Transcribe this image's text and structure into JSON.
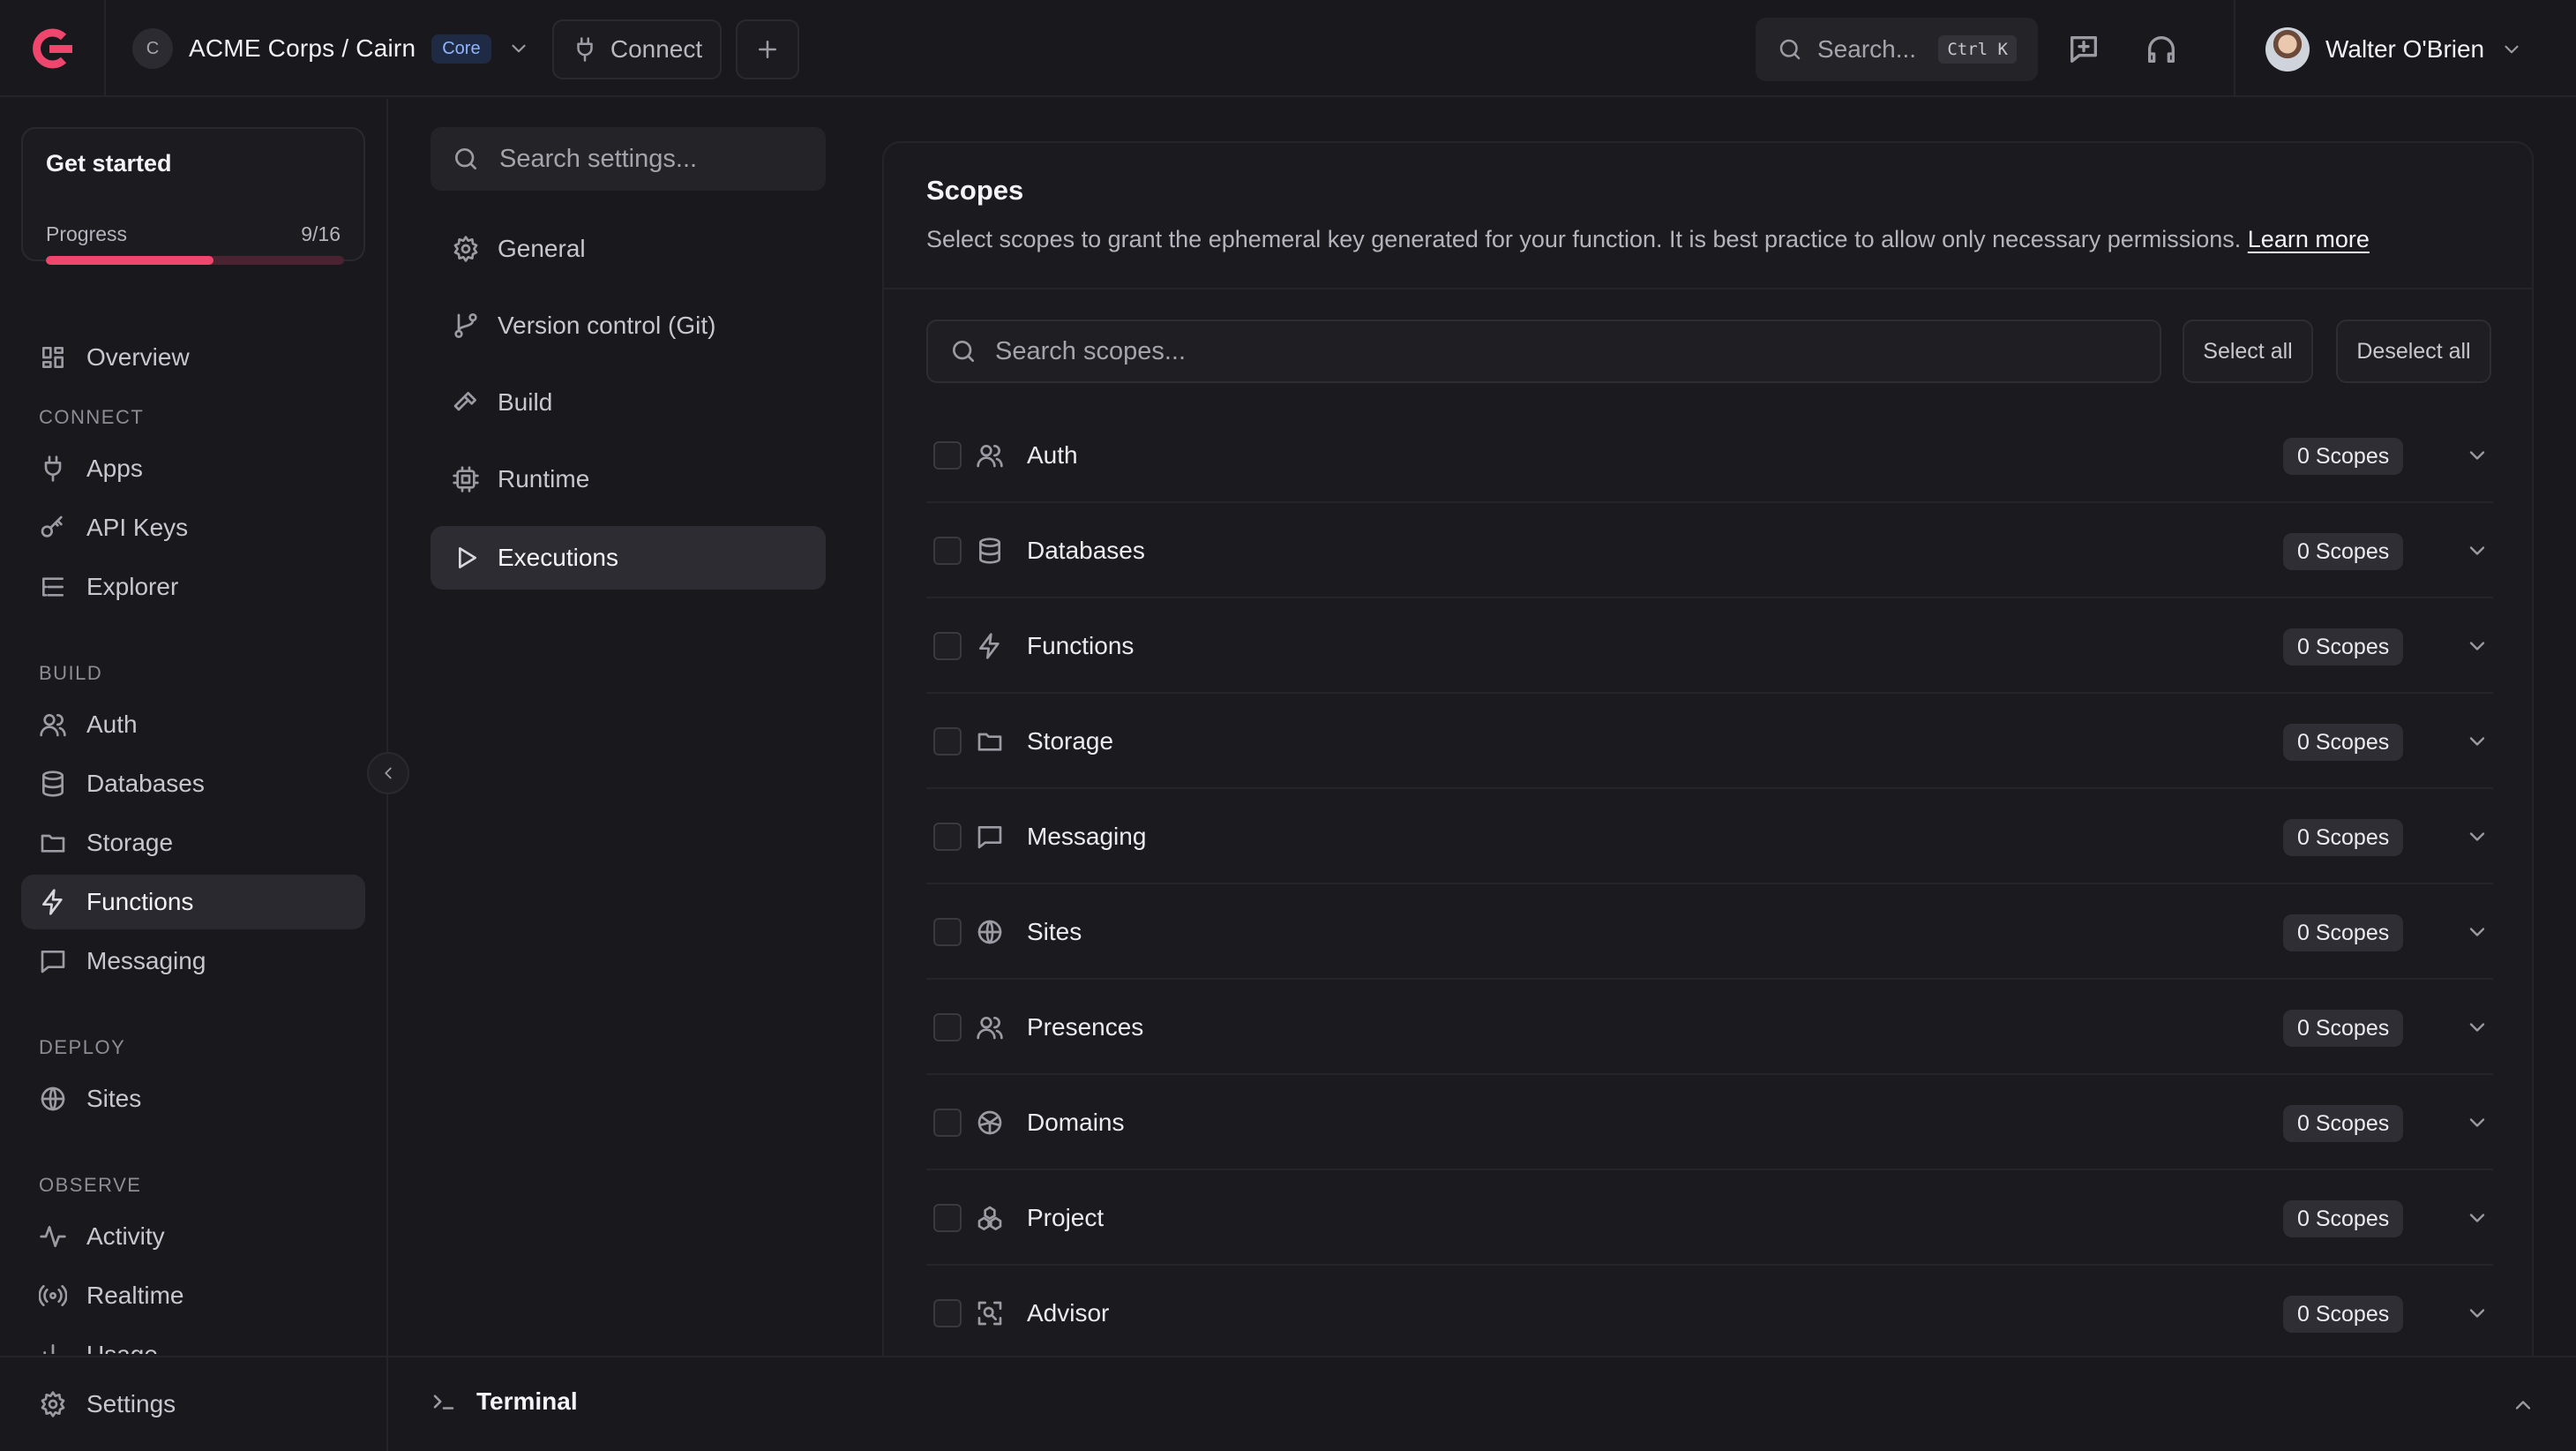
{
  "colors": {
    "accent": "#f0466d",
    "background": "#19181d",
    "active_bg": "#2a292f"
  },
  "topbar": {
    "org_initial": "C",
    "org_name": "ACME Corps / Cairn",
    "plan_badge": "Core",
    "connect_label": "Connect",
    "search_placeholder": "Search...",
    "search_shortcut": "Ctrl K",
    "user_name": "Walter O'Brien"
  },
  "get_started": {
    "title": "Get started",
    "progress_label": "Progress",
    "progress_text": "9/16",
    "progress_fraction": 0.5625
  },
  "sidebar": {
    "overview": "Overview",
    "sections": {
      "connect": "CONNECT",
      "build": "BUILD",
      "deploy": "DEPLOY",
      "observe": "OBSERVE"
    },
    "connect_items": [
      "Apps",
      "API Keys",
      "Explorer"
    ],
    "build_items": [
      "Auth",
      "Databases",
      "Storage",
      "Functions",
      "Messaging"
    ],
    "deploy_items": [
      "Sites"
    ],
    "observe_items": [
      "Activity",
      "Realtime",
      "Usage"
    ],
    "settings": "Settings",
    "active": "Functions"
  },
  "settings_nav": {
    "search_placeholder": "Search settings...",
    "items": [
      "General",
      "Version control (Git)",
      "Build",
      "Runtime",
      "Executions"
    ],
    "active": "Executions"
  },
  "scopes": {
    "title": "Scopes",
    "description": "Select scopes to grant the ephemeral key generated for your function. It is best practice to allow only necessary permissions.",
    "learn_more": "Learn more",
    "search_placeholder": "Search scopes...",
    "select_all": "Select all",
    "deselect_all": "Deselect all",
    "rows": [
      {
        "name": "Auth",
        "count": "0 Scopes",
        "icon": "users-icon"
      },
      {
        "name": "Databases",
        "count": "0 Scopes",
        "icon": "database-icon"
      },
      {
        "name": "Functions",
        "count": "0 Scopes",
        "icon": "bolt-icon"
      },
      {
        "name": "Storage",
        "count": "0 Scopes",
        "icon": "folder-icon"
      },
      {
        "name": "Messaging",
        "count": "0 Scopes",
        "icon": "message-icon"
      },
      {
        "name": "Sites",
        "count": "0 Scopes",
        "icon": "globe-icon"
      },
      {
        "name": "Presences",
        "count": "0 Scopes",
        "icon": "users-icon"
      },
      {
        "name": "Domains",
        "count": "0 Scopes",
        "icon": "globe-grid-icon"
      },
      {
        "name": "Project",
        "count": "0 Scopes",
        "icon": "cubes-icon"
      },
      {
        "name": "Advisor",
        "count": "0 Scopes",
        "icon": "scan-icon"
      }
    ]
  },
  "terminal": {
    "label": "Terminal"
  }
}
